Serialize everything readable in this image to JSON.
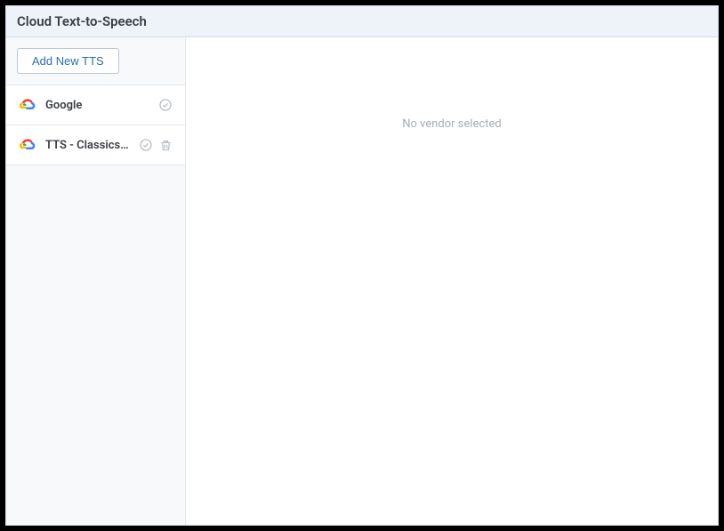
{
  "header": {
    "title": "Cloud Text-to-Speech"
  },
  "sidebar": {
    "add_button_label": "Add New TTS",
    "vendors": [
      {
        "label": "Google",
        "icon": "google-cloud",
        "show_delete": false
      },
      {
        "label": "TTS - Classics ...",
        "icon": "google-cloud",
        "show_delete": true
      }
    ]
  },
  "main": {
    "empty_message": "No vendor selected"
  }
}
